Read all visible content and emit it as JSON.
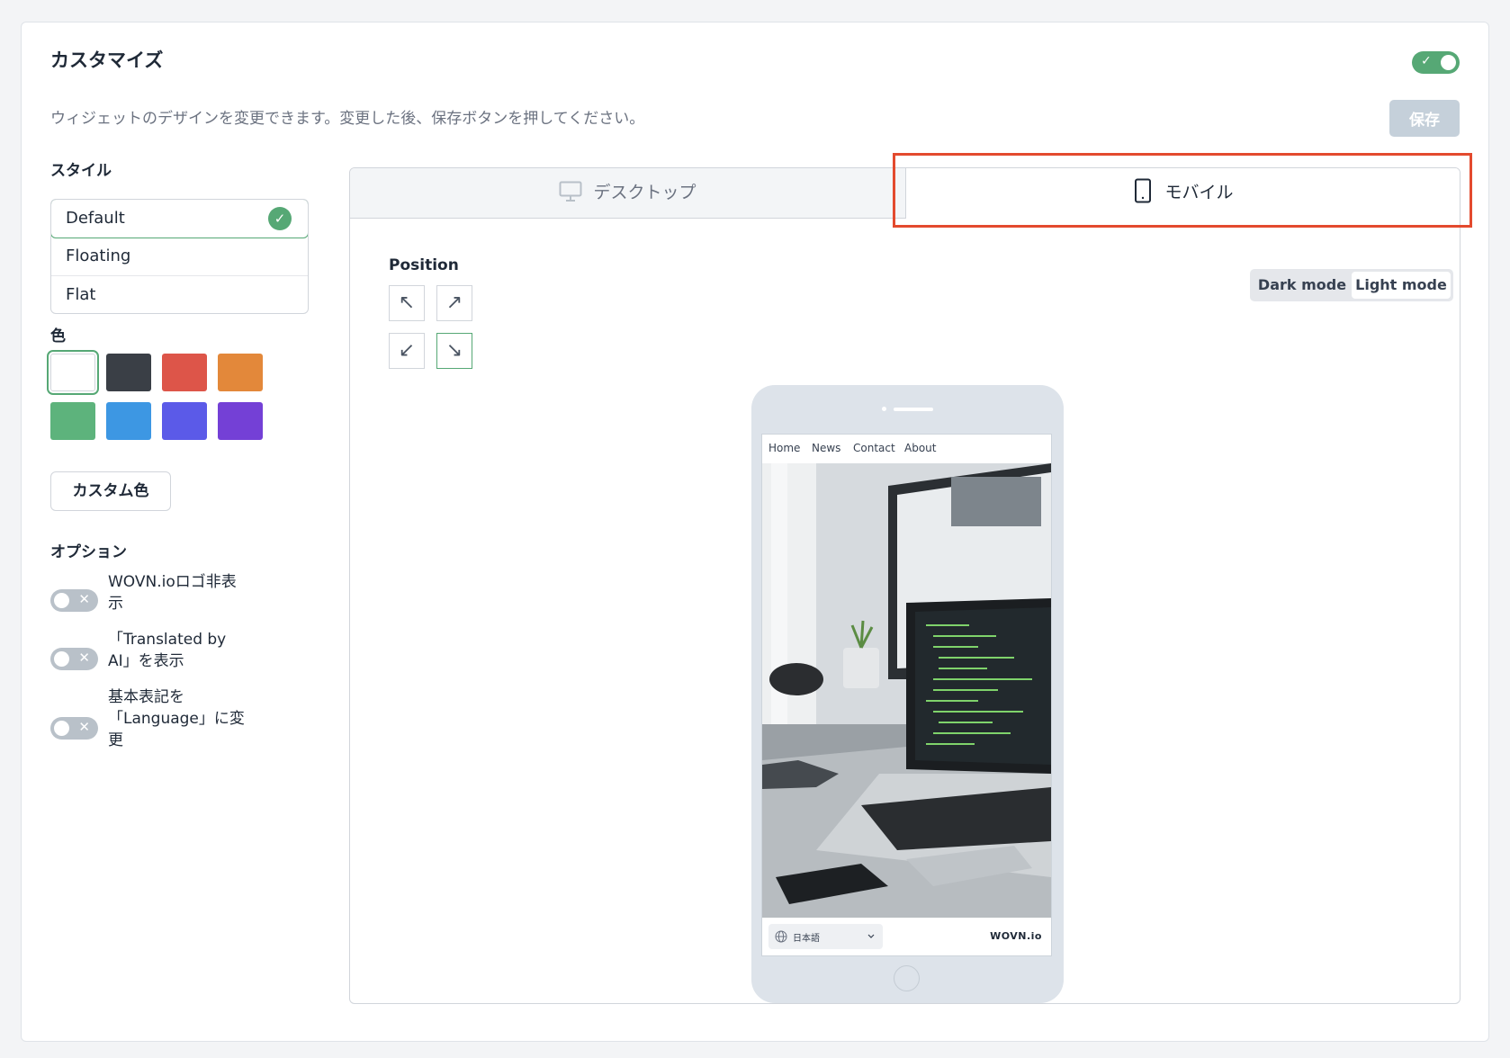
{
  "header": {
    "title": "カスタマイズ",
    "description": "ウィジェットのデザインを変更できます。変更した後、保存ボタンを押してください。",
    "save_label": "保存",
    "toggle_check": "✓"
  },
  "style": {
    "label": "スタイル",
    "options": [
      "Default",
      "Floating",
      "Flat"
    ],
    "selected": "Default",
    "check": "✓"
  },
  "color": {
    "label": "色",
    "swatches": [
      "#ffffff",
      "#3a3f46",
      "#dd5549",
      "#e3883a",
      "#5db37c",
      "#3d97e3",
      "#5b5ae8",
      "#7440d6"
    ],
    "selected_index": 0,
    "custom_label": "カスタム色"
  },
  "options": {
    "label": "オプション",
    "items": [
      {
        "lines": [
          "WOVN.ioロゴ非表",
          "示"
        ],
        "enabled": false
      },
      {
        "lines": [
          "「Translated by",
          "AI」を表示"
        ],
        "enabled": false
      },
      {
        "lines": [
          "基本表記を",
          "「Language」に変",
          "更"
        ],
        "enabled": false
      }
    ],
    "off_glyph": "✕"
  },
  "preview": {
    "tabs": [
      {
        "label": "デスクトップ",
        "icon": "monitor-icon",
        "active": false
      },
      {
        "label": "モバイル",
        "icon": "smartphone-icon",
        "active": true
      }
    ],
    "position_label": "Position",
    "position_glyphs": [
      "↖",
      "↗",
      "↙",
      "↘"
    ],
    "position_selected": "bottom-right",
    "modes": [
      "Dark mode",
      "Light mode"
    ],
    "mode_selected": "Light mode",
    "phone": {
      "nav": [
        "Home",
        "News",
        "Contact",
        "About"
      ],
      "language": "日本語",
      "brand": "WOVN.io"
    }
  },
  "colors": {
    "accent": "#56a875",
    "highlight": "#e34a2e",
    "disabled_button": "#c5d0da"
  }
}
